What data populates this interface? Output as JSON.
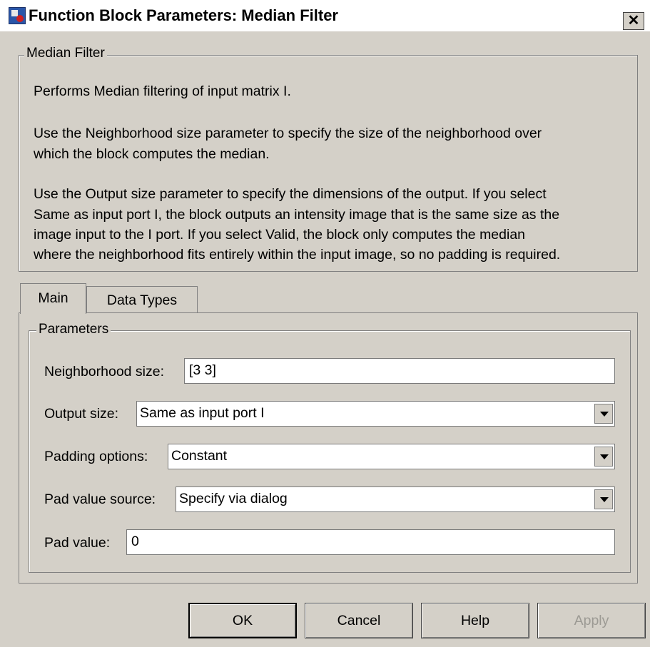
{
  "window": {
    "title": "Function Block Parameters: Median Filter",
    "close_label": "✕"
  },
  "description": {
    "group_title": "Median Filter",
    "lines": [
      "Performs Median filtering of input matrix I.",
      "Use the Neighborhood size parameter to specify the size of the neighborhood over",
      "which the block computes the median.",
      "Use the Output size parameter to specify the dimensions of the output. If you select",
      "Same as input port I, the block outputs an intensity image that is the same size as the",
      "image input to the I port. If you select Valid, the block only computes the median",
      "where the neighborhood fits entirely within the input image, so no padding is required."
    ]
  },
  "tabs": [
    {
      "label": "Main",
      "active": true
    },
    {
      "label": "Data Types",
      "active": false
    }
  ],
  "parameters": {
    "group_title": "Parameters",
    "neighborhood_size": {
      "label": "Neighborhood size:",
      "value": "[3 3]"
    },
    "output_size": {
      "label": "Output size:",
      "value": "Same as input port I"
    },
    "padding_options": {
      "label": "Padding options:",
      "value": "Constant"
    },
    "pad_value_source": {
      "label": "Pad value source:",
      "value": "Specify via dialog"
    },
    "pad_value": {
      "label": "Pad value:",
      "value": "0"
    }
  },
  "buttons": {
    "ok": "OK",
    "cancel": "Cancel",
    "help": "Help",
    "apply": "Apply"
  }
}
